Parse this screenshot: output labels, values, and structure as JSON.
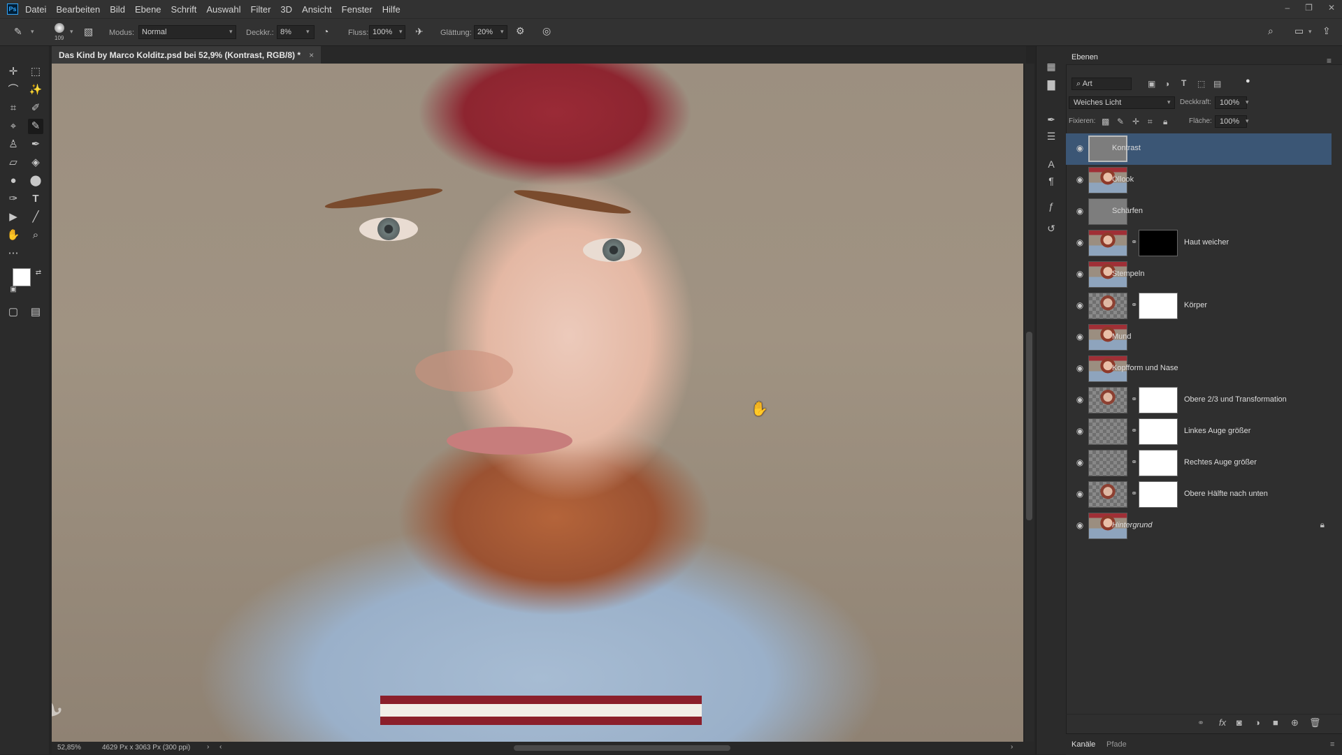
{
  "menu": {
    "logo": "Ps",
    "items": [
      "Datei",
      "Bearbeiten",
      "Bild",
      "Ebene",
      "Schrift",
      "Auswahl",
      "Filter",
      "3D",
      "Ansicht",
      "Fenster",
      "Hilfe"
    ]
  },
  "options": {
    "brush_size": "109",
    "modus_label": "Modus:",
    "modus_value": "Normal",
    "deckkraft_label": "Deckkr.:",
    "deckkraft_value": "8%",
    "fluss_label": "Fluss:",
    "fluss_value": "100%",
    "glaettung_label": "Glättung:",
    "glaettung_value": "20%"
  },
  "document": {
    "tab_title": "Das Kind by Marco Kolditz.psd bei 52,9% (Kontrast, RGB/8) *",
    "close": "×"
  },
  "status": {
    "zoom": "52,85%",
    "dimensions": "4629 Px x 3063 Px (300 ppi)"
  },
  "layers_panel": {
    "tab": "Ebenen",
    "filter_kind": "Art",
    "blend_mode": "Weiches Licht",
    "opacity_label": "Deckkraft:",
    "opacity_value": "100%",
    "lock_label": "Fixieren:",
    "fill_label": "Fläche:",
    "fill_value": "100%",
    "layers": [
      {
        "name": "Kontrast",
        "thumb": "gray",
        "mask": null,
        "selected": true
      },
      {
        "name": "Öllook",
        "thumb": "photo",
        "mask": null
      },
      {
        "name": "Schärfen",
        "thumb": "gray",
        "mask": null
      },
      {
        "name": "Haut weicher",
        "thumb": "photo",
        "mask": "black"
      },
      {
        "name": "Stempeln",
        "thumb": "photo",
        "mask": null
      },
      {
        "name": "Körper",
        "thumb": "photochk",
        "mask": "white"
      },
      {
        "name": "Mund",
        "thumb": "photo",
        "mask": null
      },
      {
        "name": "Kopfform und Nase",
        "thumb": "photo",
        "mask": null
      },
      {
        "name": "Obere 2/3 und Transformation",
        "thumb": "photochk",
        "mask": "white"
      },
      {
        "name": "Linkes Auge größer",
        "thumb": "checker",
        "mask": "white"
      },
      {
        "name": "Rechtes Auge größer",
        "thumb": "checker",
        "mask": "white"
      },
      {
        "name": "Obere Hälfte nach unten",
        "thumb": "photochk",
        "mask": "white"
      },
      {
        "name": "Hintergrund",
        "thumb": "photo",
        "mask": null,
        "italic": true,
        "locked": true
      }
    ]
  },
  "bottom_tabs": [
    "Kanäle",
    "Pfade"
  ],
  "colors": {
    "selection": "#3b5675",
    "foreground": "#ffffff",
    "background": "#000000"
  }
}
